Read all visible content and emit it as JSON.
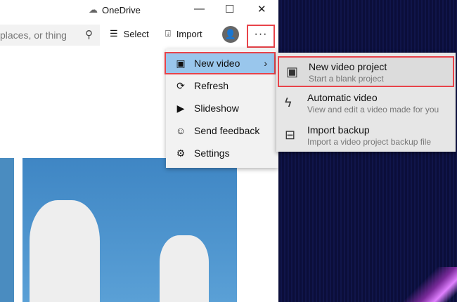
{
  "window": {
    "title": "OneDrive"
  },
  "toolbar": {
    "search_placeholder": "places, or thing",
    "select": "Select",
    "import": "Import",
    "more": "···"
  },
  "menu": {
    "items": [
      {
        "label": "New video",
        "icon": "video-icon"
      },
      {
        "label": "Refresh",
        "icon": "refresh-icon"
      },
      {
        "label": "Slideshow",
        "icon": "slideshow-icon"
      },
      {
        "label": "Send feedback",
        "icon": "feedback-icon"
      },
      {
        "label": "Settings",
        "icon": "gear-icon"
      }
    ]
  },
  "submenu": {
    "items": [
      {
        "title": "New video project",
        "desc": "Start a blank project"
      },
      {
        "title": "Automatic video",
        "desc": "View and edit a video made for you"
      },
      {
        "title": "Import backup",
        "desc": "Import a video project backup file"
      }
    ]
  },
  "colors": {
    "highlight": "#99c6ec",
    "callout": "#e8434a"
  }
}
